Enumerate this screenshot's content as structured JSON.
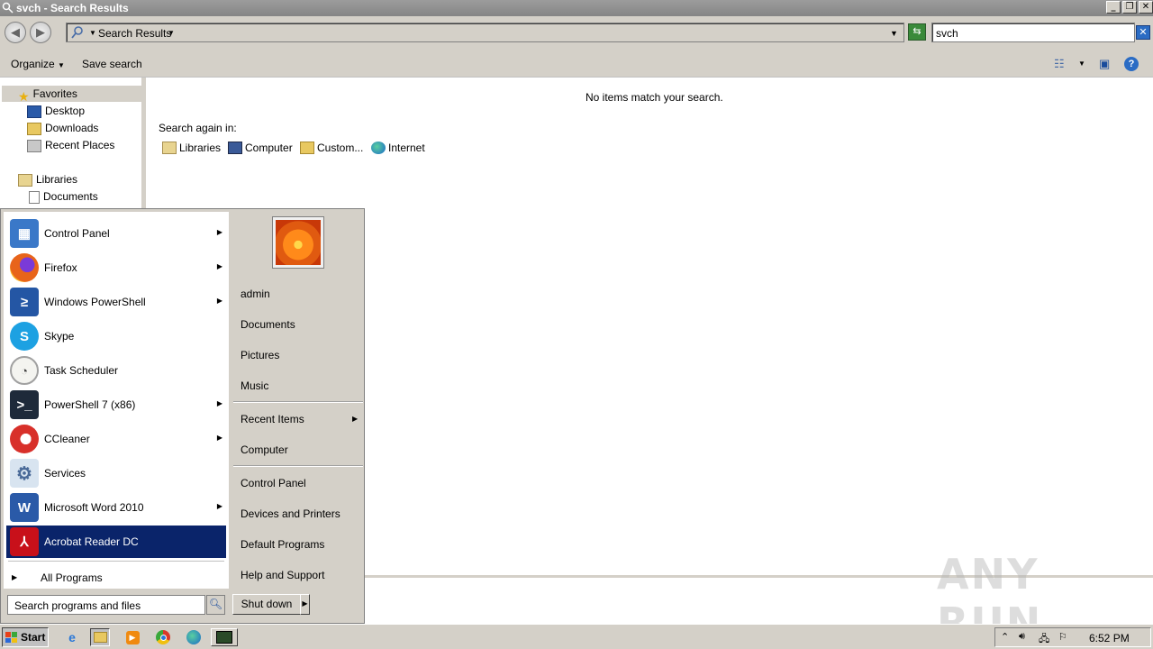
{
  "window": {
    "title": "svch - Search Results",
    "controls": [
      "_",
      "❐",
      "✕"
    ]
  },
  "address": {
    "path": "Search Results",
    "search_value": "svch"
  },
  "toolbar": {
    "organize": "Organize",
    "save_search": "Save search"
  },
  "nav": {
    "favorites": "Favorites",
    "desktop": "Desktop",
    "downloads": "Downloads",
    "recent_places": "Recent Places",
    "libraries": "Libraries",
    "documents": "Documents"
  },
  "content": {
    "no_items": "No items match your search.",
    "search_again": "Search again in:",
    "locations": [
      "Libraries",
      "Computer",
      "Custom...",
      "Internet"
    ]
  },
  "start_menu": {
    "programs": [
      {
        "label": "Control Panel",
        "submenu": true,
        "icon": "control-panel-icon",
        "color": "#3a78c8"
      },
      {
        "label": "Firefox",
        "submenu": true,
        "icon": "firefox-icon",
        "color": "#e8641a"
      },
      {
        "label": "Windows PowerShell",
        "submenu": true,
        "icon": "powershell-icon",
        "color": "#2456a4"
      },
      {
        "label": "Skype",
        "submenu": false,
        "icon": "skype-icon",
        "color": "#1da1e2"
      },
      {
        "label": "Task Scheduler",
        "submenu": false,
        "icon": "clock-icon",
        "color": "#c8c8c8"
      },
      {
        "label": "PowerShell 7 (x86)",
        "submenu": true,
        "icon": "powershell7-icon",
        "color": "#1e2a3a"
      },
      {
        "label": "CCleaner",
        "submenu": true,
        "icon": "ccleaner-icon",
        "color": "#d8302a"
      },
      {
        "label": "Services",
        "submenu": false,
        "icon": "gears-icon",
        "color": "#7a9ab8"
      },
      {
        "label": "Microsoft Word 2010",
        "submenu": true,
        "icon": "word-icon",
        "color": "#2a5aa8"
      },
      {
        "label": "Acrobat Reader DC",
        "submenu": false,
        "icon": "acrobat-icon",
        "color": "#c8101a",
        "highlighted": true
      }
    ],
    "all_programs": "All Programs",
    "search_placeholder": "Search programs and files",
    "right_items": [
      "admin",
      "Documents",
      "Pictures",
      "Music",
      "Recent Items",
      "Computer",
      "Control Panel",
      "Devices and Printers",
      "Default Programs",
      "Help and Support"
    ],
    "shutdown": "Shut down"
  },
  "taskbar": {
    "start": "Start",
    "clock": "6:52 PM"
  },
  "watermark": "ANY RUN"
}
